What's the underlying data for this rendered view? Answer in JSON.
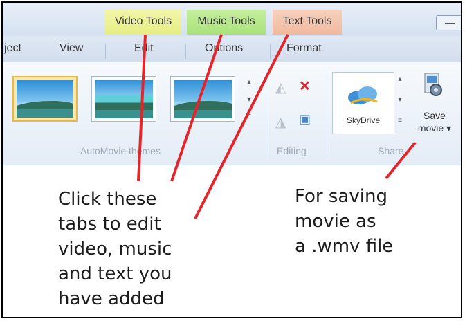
{
  "ribbon": {
    "context_tabs": {
      "video": "Video Tools",
      "music": "Music Tools",
      "text": "Text Tools"
    },
    "tabs": [
      "ject",
      "View",
      "Edit",
      "Options",
      "Format"
    ],
    "groups": {
      "automovie": "AutoMovie themes",
      "editing": "Editing",
      "share": "Share"
    },
    "skydrive_label": "SkyDrive",
    "save_movie": "Save movie ▾"
  },
  "annotations": {
    "tabs_note": "Click these\ntabs to edit\nvideo, music\nand text you\nhave added",
    "save_note": "For saving\nmovie as\na .wmv file"
  },
  "colors": {
    "annotation_line": "#e3262b",
    "video_tools": "#e7ee85",
    "music_tools": "#a9e27a",
    "text_tools": "#f0b99e",
    "theme_selected": "#e8b94a"
  },
  "icons": [
    "rotate-left-icon",
    "remove-icon",
    "rotate-right-icon",
    "select-all-icon",
    "skydrive-icon",
    "save-movie-icon"
  ]
}
